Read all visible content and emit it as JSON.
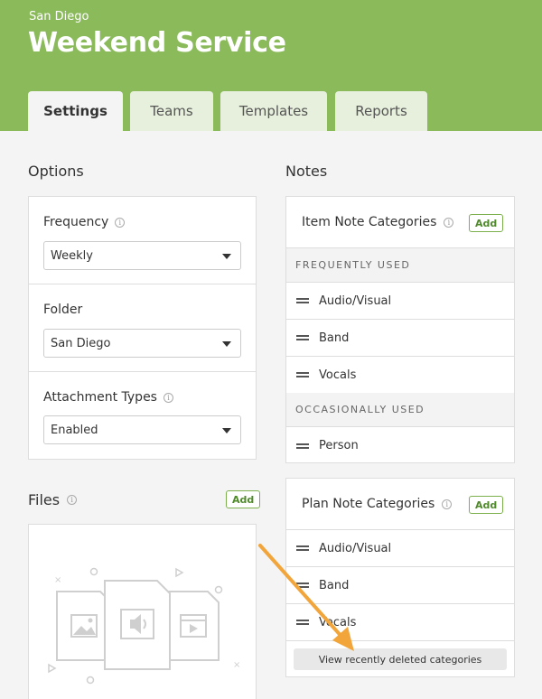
{
  "header": {
    "org": "San Diego",
    "title": "Weekend Service",
    "tabs": [
      {
        "label": "Settings"
      },
      {
        "label": "Teams"
      },
      {
        "label": "Templates"
      },
      {
        "label": "Reports"
      }
    ]
  },
  "options": {
    "title": "Options",
    "fields": [
      {
        "label": "Frequency",
        "value": "Weekly"
      },
      {
        "label": "Folder",
        "value": "San Diego"
      },
      {
        "label": "Attachment Types",
        "value": "Enabled"
      }
    ]
  },
  "files": {
    "title": "Files",
    "add_label": "Add"
  },
  "notes": {
    "title": "Notes",
    "item_categories": {
      "title": "Item Note Categories",
      "add_label": "Add",
      "groups": [
        {
          "label": "FREQUENTLY USED",
          "items": [
            "Audio/Visual",
            "Band",
            "Vocals"
          ]
        },
        {
          "label": "OCCASIONALLY USED",
          "items": [
            "Person"
          ]
        }
      ]
    },
    "plan_categories": {
      "title": "Plan Note Categories",
      "add_label": "Add",
      "items": [
        "Audio/Visual",
        "Band",
        "Vocals"
      ],
      "deleted_button": "View recently deleted categories"
    }
  },
  "colors": {
    "header_bg": "#8aba5a",
    "accent_green": "#4f8a2a",
    "arrow": "#f2a53a"
  },
  "icons": [
    "info-icon",
    "drag-handle-icon",
    "image-file-icon",
    "audio-file-icon",
    "video-file-icon",
    "dropdown-caret-icon"
  ]
}
